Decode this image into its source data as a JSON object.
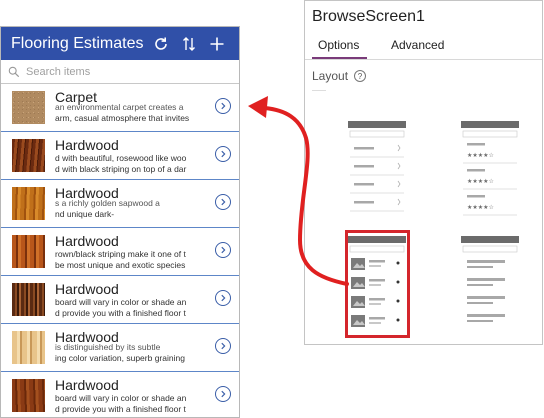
{
  "app": {
    "title": "Flooring Estimates",
    "icons": {
      "refresh": "refresh-icon",
      "sort": "sort-icon",
      "add": "add-icon"
    },
    "search": {
      "placeholder": "Search items"
    },
    "items": [
      {
        "title": "Carpet",
        "line_top": "an environmental carpet creates a",
        "line_bottom": "arm, casual atmosphere that invites",
        "swatch": "carpet"
      },
      {
        "title": "Hardwood",
        "line_top": "d with beautiful, rosewood like woo",
        "line_bottom": "d with black striping on top of a dar",
        "swatch": "rosewood"
      },
      {
        "title": "Hardwood",
        "line_top": "s a richly golden sapwood a",
        "line_bottom": "nd unique dark-",
        "swatch": "golden"
      },
      {
        "title": "Hardwood",
        "line_top": "rown/black striping make it one of t",
        "line_bottom": "be most unique and exotic species",
        "swatch": "exotic"
      },
      {
        "title": "Hardwood",
        "line_top": "board will vary in color or shade an",
        "line_bottom": "d provide you with a finished floor t",
        "swatch": "dark"
      },
      {
        "title": "Hardwood",
        "line_top": "is distinguished by its subtle",
        "line_bottom": "ing color variation, superb graining",
        "swatch": "light"
      },
      {
        "title": "Hardwood",
        "line_top": "board will vary in color or shade an",
        "line_bottom": "d provide you with a finished floor t",
        "swatch": "cherry"
      }
    ]
  },
  "panel": {
    "title": "BrowseScreen1",
    "tabs": [
      "Options",
      "Advanced"
    ],
    "active_tab": "Options",
    "layout_label": "Layout",
    "help_glyph": "?",
    "layouts": [
      "list-with-chevrons",
      "list-with-ratings",
      "list-with-images",
      "title-list"
    ],
    "selected_layout": "list-with-images"
  },
  "colors": {
    "header": "#3050a8",
    "divider": "#5d86c8",
    "highlight": "#d4262c",
    "arrow": "#e02020"
  }
}
